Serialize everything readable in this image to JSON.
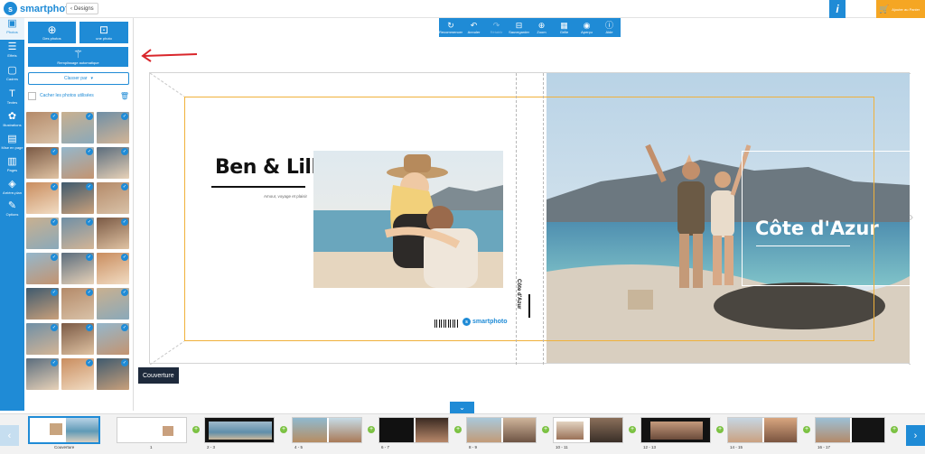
{
  "app": {
    "brand": "smartphoto",
    "back_label": "Designs"
  },
  "header": {
    "info_label": "i",
    "cart_label": "Ajouter au Panier"
  },
  "sidebar": {
    "items": [
      {
        "label": "Photos",
        "icon": "photos-icon"
      },
      {
        "label": "Effets",
        "icon": "sliders-icon"
      },
      {
        "label": "Cadres",
        "icon": "frame-icon"
      },
      {
        "label": "Textes",
        "icon": "text-icon"
      },
      {
        "label": "Illustrations",
        "icon": "illustration-icon"
      },
      {
        "label": "Mise en page",
        "icon": "layout-icon"
      },
      {
        "label": "Pages",
        "icon": "pages-icon"
      },
      {
        "label": "Arrière-plan",
        "icon": "background-icon"
      },
      {
        "label": "Options",
        "icon": "options-icon"
      }
    ]
  },
  "panel": {
    "add_photos": "Des photos",
    "one_photo": "une photo",
    "autofill": "Remplissage automatique",
    "sort_label": "Classer par",
    "hide_used": "Cacher les photos utilisées",
    "photo_count": 24
  },
  "toolbar": {
    "buttons": [
      {
        "label": "Recommencer",
        "glyph": "↻",
        "enabled": true
      },
      {
        "label": "Annuler",
        "glyph": "↶",
        "enabled": true
      },
      {
        "label": "Rétablir",
        "glyph": "↷",
        "enabled": false
      },
      {
        "label": "Sauvegarder",
        "glyph": "⊟",
        "enabled": true
      },
      {
        "label": "Zoom",
        "glyph": "⊕",
        "enabled": true
      },
      {
        "label": "Grille",
        "glyph": "▦",
        "enabled": true
      },
      {
        "label": "Aperçu",
        "glyph": "◉",
        "enabled": true
      },
      {
        "label": "Aide",
        "glyph": "ⓘ",
        "enabled": true
      }
    ]
  },
  "cover": {
    "title": "Ben & Lilly",
    "subtitle": "Amour, voyage et plaisir",
    "spine_text": "Côte d'Azur",
    "back_title": "Côte d'Azur",
    "brand": "smartphoto",
    "label": "Couverture"
  },
  "strip": {
    "spreads": [
      {
        "label": "Couverture"
      },
      {
        "label": "1"
      },
      {
        "label": "2 - 3"
      },
      {
        "label": "4 - 5"
      },
      {
        "label": "6 - 7"
      },
      {
        "label": "8 - 9"
      },
      {
        "label": "10 - 11"
      },
      {
        "label": "12 - 13"
      },
      {
        "label": "14 - 15"
      },
      {
        "label": "16 - 17"
      }
    ]
  },
  "colors": {
    "accent": "#1f8bd6",
    "cart": "#f5a623",
    "bleed": "#f0b13b",
    "label_bg": "#1e2a3c",
    "plus": "#7cc243"
  }
}
